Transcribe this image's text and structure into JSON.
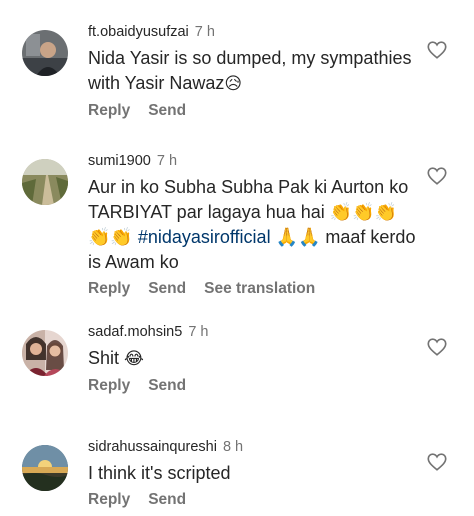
{
  "comments": [
    {
      "username": "ft.obaidyusufzai",
      "time": "7 h",
      "text_before": "Nida Yasir is so dumped, my sympathies with Yasir Nawaz",
      "hashtag": "",
      "text_after": "",
      "emoji_end": "😥",
      "actions": [
        "Reply",
        "Send"
      ]
    },
    {
      "username": "sumi1900",
      "time": "7 h",
      "text_before": "Aur in ko Subha Subha Pak ki Aurton ko TARBIYAT par lagaya hua hai 👏👏👏👏👏 ",
      "hashtag": "#nidayasirofficial",
      "text_after": " 🙏🙏 maaf kerdo is Awam ko",
      "emoji_end": "",
      "actions": [
        "Reply",
        "Send",
        "See translation"
      ]
    },
    {
      "username": "sadaf.mohsin5",
      "time": "7 h",
      "text_before": "Shit ",
      "hashtag": "",
      "text_after": "",
      "emoji_end": "😂",
      "actions": [
        "Reply",
        "Send"
      ]
    },
    {
      "username": "sidrahussainqureshi",
      "time": "8 h",
      "text_before": "I think it's scripted",
      "hashtag": "",
      "text_after": "",
      "emoji_end": "",
      "actions": [
        "Reply",
        "Send"
      ]
    }
  ],
  "icons": {
    "like": "heart-outline-icon"
  },
  "colors": {
    "username": "#262626",
    "meta": "#737373",
    "hashtag": "#00376b"
  }
}
